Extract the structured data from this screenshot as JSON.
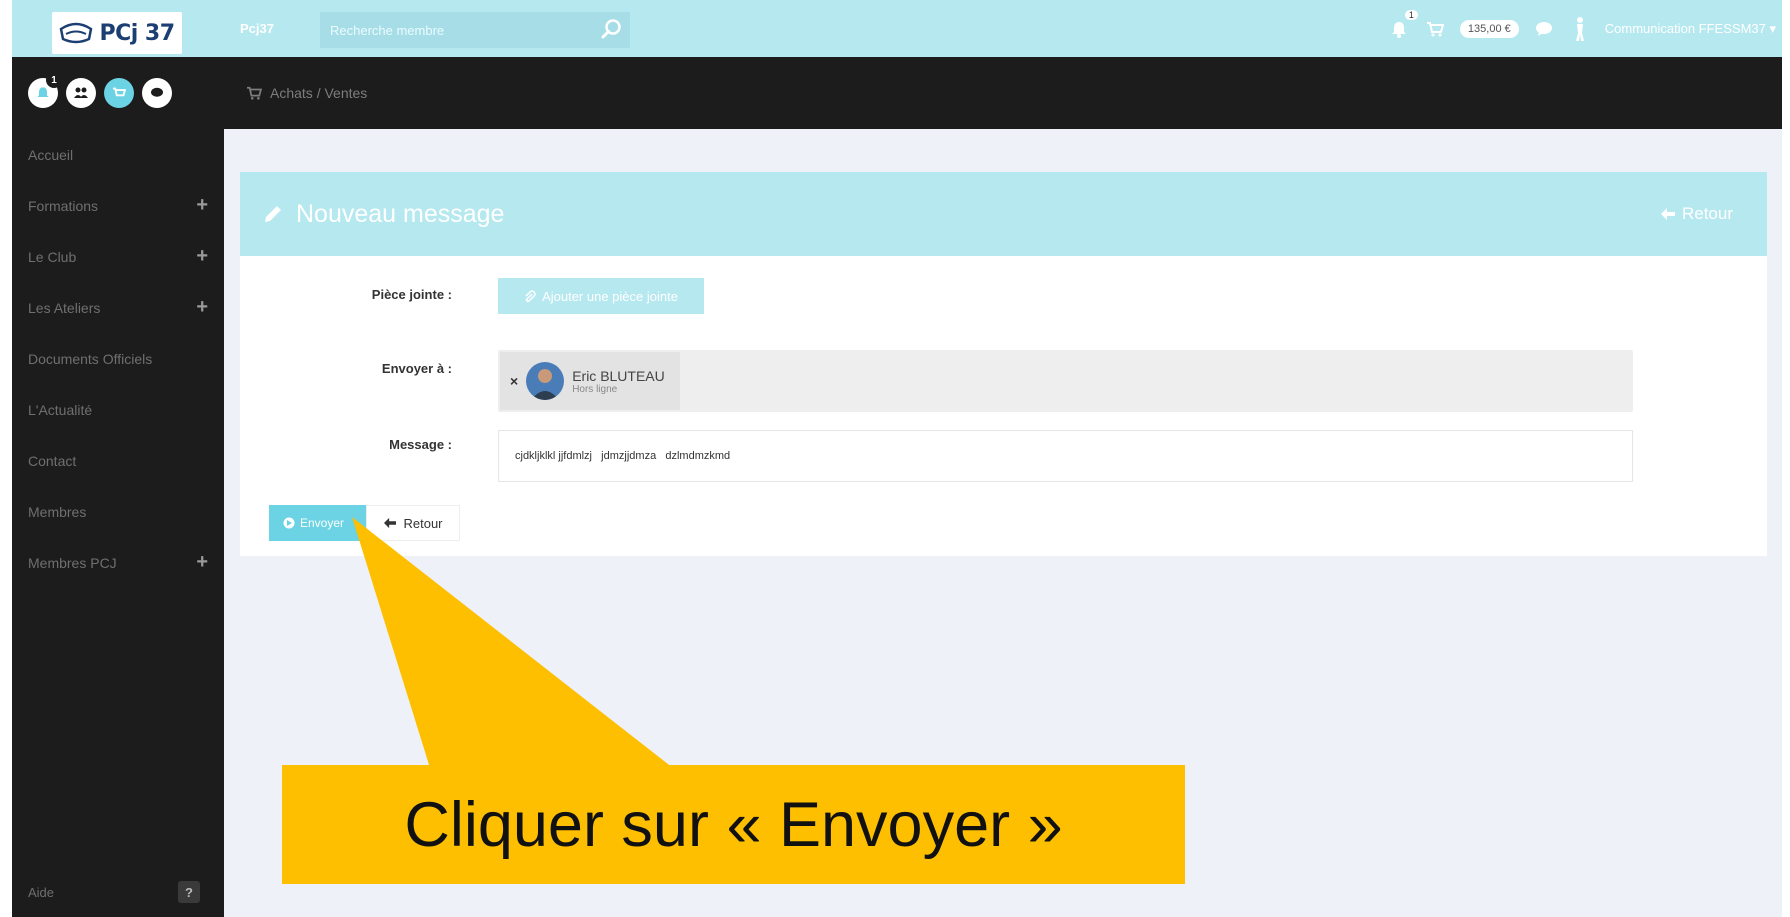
{
  "topbar": {
    "logo_text": "PCj 37",
    "brand": "Pcj37",
    "search_placeholder": "Recherche membre",
    "notif_count": "1",
    "cart_amount": "135,00 €",
    "user_name": "Communication FFESSM37 ▾"
  },
  "sidebar": {
    "notif_badge": "1",
    "items": [
      {
        "label": "Accueil",
        "expandable": false
      },
      {
        "label": "Formations",
        "expandable": true
      },
      {
        "label": "Le Club",
        "expandable": true
      },
      {
        "label": "Les Ateliers",
        "expandable": true
      },
      {
        "label": "Documents Officiels",
        "expandable": false
      },
      {
        "label": "L'Actualité",
        "expandable": false
      },
      {
        "label": "Contact",
        "expandable": false
      },
      {
        "label": "Membres",
        "expandable": false
      },
      {
        "label": "Membres PCJ",
        "expandable": true
      }
    ],
    "plus_glyph": "+",
    "aide_label": "Aide",
    "aide_glyph": "?"
  },
  "breadcrumb": {
    "label": "Achats / Ventes"
  },
  "panel": {
    "title": "Nouveau message",
    "back_label": "Retour"
  },
  "form": {
    "attachment_label": "Pièce jointe :",
    "attachment_button": "Ajouter une pièce jointe",
    "recipient_label": "Envoyer à :",
    "recipient_remove": "×",
    "recipient_name": "Eric BLUTEAU",
    "recipient_status": "Hors ligne",
    "message_label": "Message :",
    "message_value": "cjdkljklkl jjfdmlzj   jdmzjjdmza   dzlmdmzkmd",
    "send_button": "Envoyer",
    "cancel_button": "Retour"
  },
  "callout": {
    "text": "Cliquer sur « Envoyer »"
  },
  "colors": {
    "accent_light": "#b6e8f0",
    "accent": "#6bd3e4",
    "dark": "#1c1c1c",
    "callout": "#fdbf00"
  }
}
